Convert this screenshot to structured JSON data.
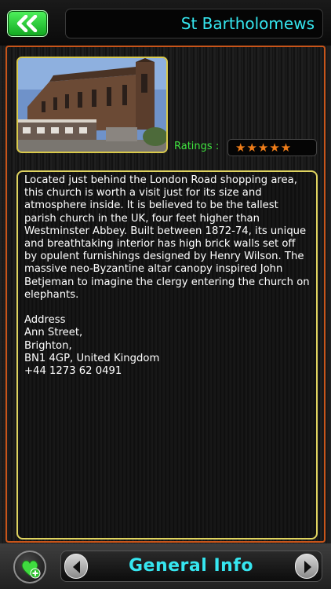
{
  "header": {
    "title": "St Bartholomews",
    "back_icon": "double-chevron-left-icon"
  },
  "detail": {
    "ratings_label": "Ratings :",
    "rating": 5,
    "rating_max": 5,
    "stars_text": "★★★★★",
    "description": "Located just behind the London Road shopping area, this church is worth a visit just for its size and atmosphere inside. It is believed to be the tallest parish church in the UK, four feet higher than Westminster Abbey. Built between 1872-74, its unique and breathtaking interior has high brick walls set off by opulent furnishings designed by Henry Wilson. The massive neo-Byzantine altar canopy inspired John Betjeman to imagine the clergy entering the church on elephants.\n\nAddress\nAnn Street,\nBrighton,\nBN1 4GP, United Kingdom\n+44 1273 62 0491"
  },
  "footer": {
    "section_label": "General Info",
    "favorite_icon": "heart-plus-icon",
    "prev_icon": "triangle-left-icon",
    "next_icon": "triangle-right-icon"
  },
  "colors": {
    "accent_cyan": "#35e6ef",
    "accent_green": "#3fe33f",
    "star_orange": "#ef7d19",
    "panel_border": "#c8551a",
    "box_border": "#e0d460"
  }
}
